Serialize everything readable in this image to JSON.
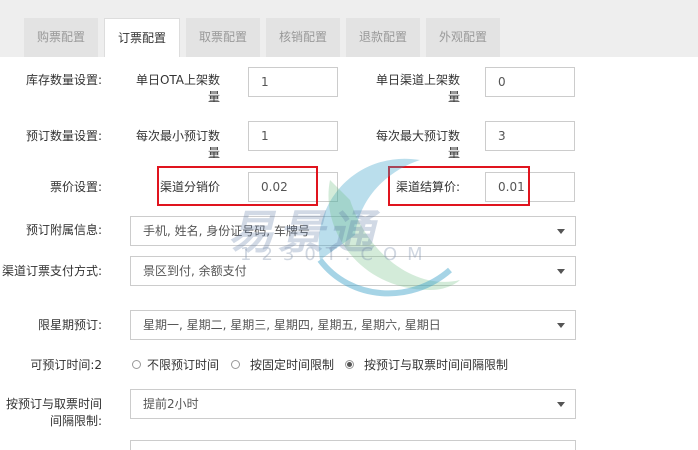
{
  "tabs": [
    {
      "label": "购票配置"
    },
    {
      "label": "订票配置"
    },
    {
      "label": "取票配置"
    },
    {
      "label": "核销配置"
    },
    {
      "label": "退款配置"
    },
    {
      "label": "外观配置"
    }
  ],
  "active_tab_index": 1,
  "inventory": {
    "label": "库存数量设置:",
    "ota_label": "单日OTA上架数量",
    "ota_value": "1",
    "channel_label": "单日渠道上架数量",
    "channel_value": "0"
  },
  "booking_qty": {
    "label": "预订数量设置:",
    "min_label": "每次最小预订数量",
    "min_value": "1",
    "max_label": "每次最大预订数量",
    "max_value": "3"
  },
  "price": {
    "label": "票价设置:",
    "dist_label": "渠道分销价",
    "dist_value": "0.02",
    "settle_label": "渠道结算价:",
    "settle_value": "0.01"
  },
  "extra_info": {
    "label": "预订附属信息:",
    "value": "手机, 姓名, 身份证号码, 车牌号"
  },
  "payment": {
    "label": "渠道订票支付方式:",
    "value": "景区到付, 余额支付"
  },
  "weekday": {
    "label": "限星期预订:",
    "value": "星期一, 星期二, 星期三, 星期四, 星期五, 星期六, 星期日"
  },
  "time_limit": {
    "label": "可预订时间:2",
    "options": [
      "不限预订时间",
      "按固定时间限制",
      "按预订与取票时间间隔限制"
    ],
    "selected_index": 2
  },
  "interval": {
    "label": "按预订与取票时间间隔限制:",
    "value": "提前2小时"
  },
  "watermark": {
    "text": "易景通",
    "sub": "1230T.COM",
    "color": "#3aa0c8"
  },
  "highlight_color": "#e0141e"
}
